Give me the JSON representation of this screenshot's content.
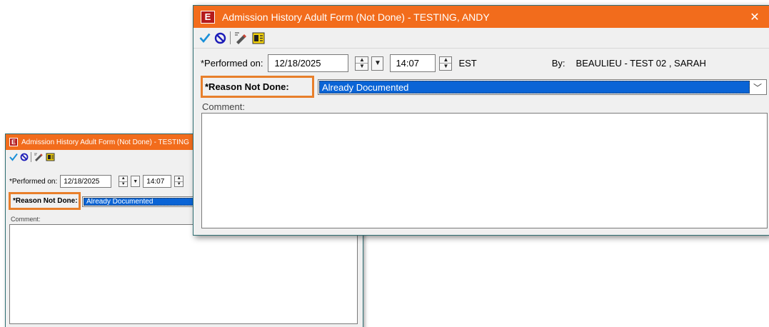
{
  "window": {
    "title": "Admission History Adult Form (Not Done) - TESTING, ANDY",
    "title_truncated": "Admission History Adult Form (Not Done) - TESTING"
  },
  "icons": {
    "sign": "checkmark-icon",
    "cancel": "no-entry-icon",
    "pencil": "pencil-icon",
    "form": "form-browser-icon"
  },
  "form": {
    "performed_label": "*Performed on:",
    "date": "12/18/2025",
    "time": "14:07",
    "timezone": "EST",
    "by_label": "By:",
    "by_value": "BEAULIEU - TEST 02 , SARAH",
    "reason_label": "*Reason Not Done:",
    "reason_value": "Already Documented",
    "comment_label": "Comment:"
  },
  "colors": {
    "titlebar": "#f26c1c",
    "highlight": "#e87f2b",
    "selection": "#0a64d6",
    "checkmark": "#1a8fd8",
    "cancel": "#1c1cb8"
  }
}
